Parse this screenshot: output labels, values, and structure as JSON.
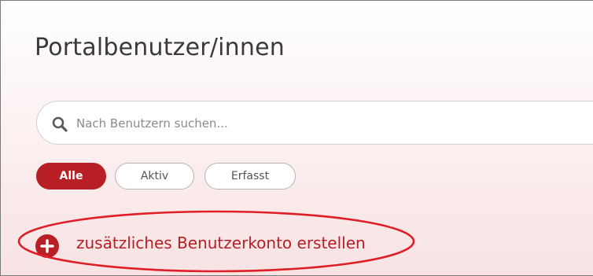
{
  "page": {
    "title": "Portalbenutzer/innen"
  },
  "search": {
    "placeholder": "Nach Benutzern suchen...",
    "value": "",
    "icon": "search-icon"
  },
  "filters": {
    "active": "Alle",
    "items": [
      {
        "label": "Alle",
        "selected": true
      },
      {
        "label": "Aktiv",
        "selected": false
      },
      {
        "label": "Erfasst",
        "selected": false
      }
    ]
  },
  "create_account": {
    "label": "zusätzliches Benutzerkonto erstellen",
    "icon": "plus-circle-icon"
  },
  "colors": {
    "accent": "#b81f25",
    "highlight": "#e01e26",
    "title_text": "#3a3a3a"
  }
}
